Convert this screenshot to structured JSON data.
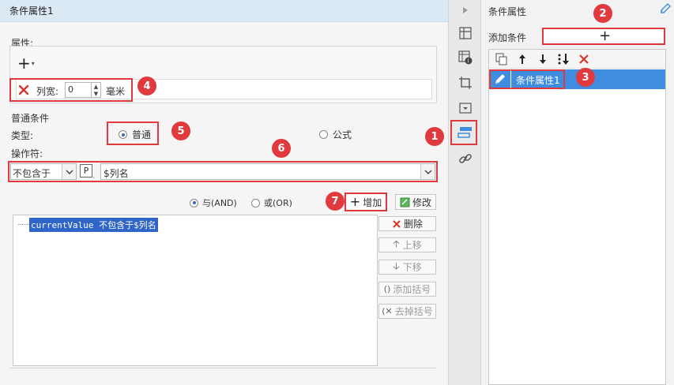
{
  "left_panel": {
    "title": "条件属性1",
    "attributes": {
      "label": "属性:",
      "add_symbol": "+",
      "row": {
        "name": "列宽:",
        "value": "0",
        "unit": "毫米"
      }
    },
    "general": {
      "label": "普通条件",
      "type_label": "类型:",
      "type_options": [
        "普通",
        "公式"
      ],
      "type_selected": "普通",
      "operator_label": "操作符:",
      "operator_value": "不包含于",
      "param_icon": "P",
      "value": "$列名"
    },
    "logic": {
      "and_label": "与(AND)",
      "or_label": "或(OR)",
      "selected": "与(AND)"
    },
    "buttons": {
      "add": "增加",
      "modify": "修改",
      "delete": "删除",
      "move_up": "上移",
      "move_down": "下移",
      "add_paren": "添加括号",
      "remove_paren": "去掉括号"
    },
    "condition_list": [
      "currentValue 不包含于$列名"
    ]
  },
  "right_panel": {
    "title": "条件属性",
    "add_condition_label": "添加条件",
    "add_symbol": "+",
    "items": [
      {
        "label": "条件属性1",
        "selected": true
      }
    ]
  },
  "badges": [
    "1",
    "2",
    "3",
    "4",
    "5",
    "6",
    "7"
  ],
  "icons": {
    "left_panel": [
      "close-x-icon",
      "spin-up-icon",
      "spin-down-icon",
      "dropdown-arrow-icon",
      "param-p-icon",
      "plus-icon",
      "edit-icon",
      "delete-x-icon",
      "arrow-up-icon",
      "arrow-down-icon",
      "add-paren-icon",
      "remove-paren-icon"
    ],
    "middle_strip": [
      "collapse-arrow-icon",
      "cell-element-icon",
      "cell-attribute-icon",
      "widget-icon",
      "window-icon",
      "condition-attribute-icon",
      "hyperlink-icon"
    ],
    "right_panel": [
      "pencil-check-icon",
      "copy-icon",
      "arrow-up-icon",
      "arrow-down-icon",
      "sort-down-icon",
      "delete-x-icon",
      "pencil-icon"
    ]
  },
  "colors": {
    "title_bar": "#dbe9f5",
    "highlight_red": "#e0393e",
    "selection_blue": "#3e8de0",
    "text_selection": "#2f64c9"
  }
}
